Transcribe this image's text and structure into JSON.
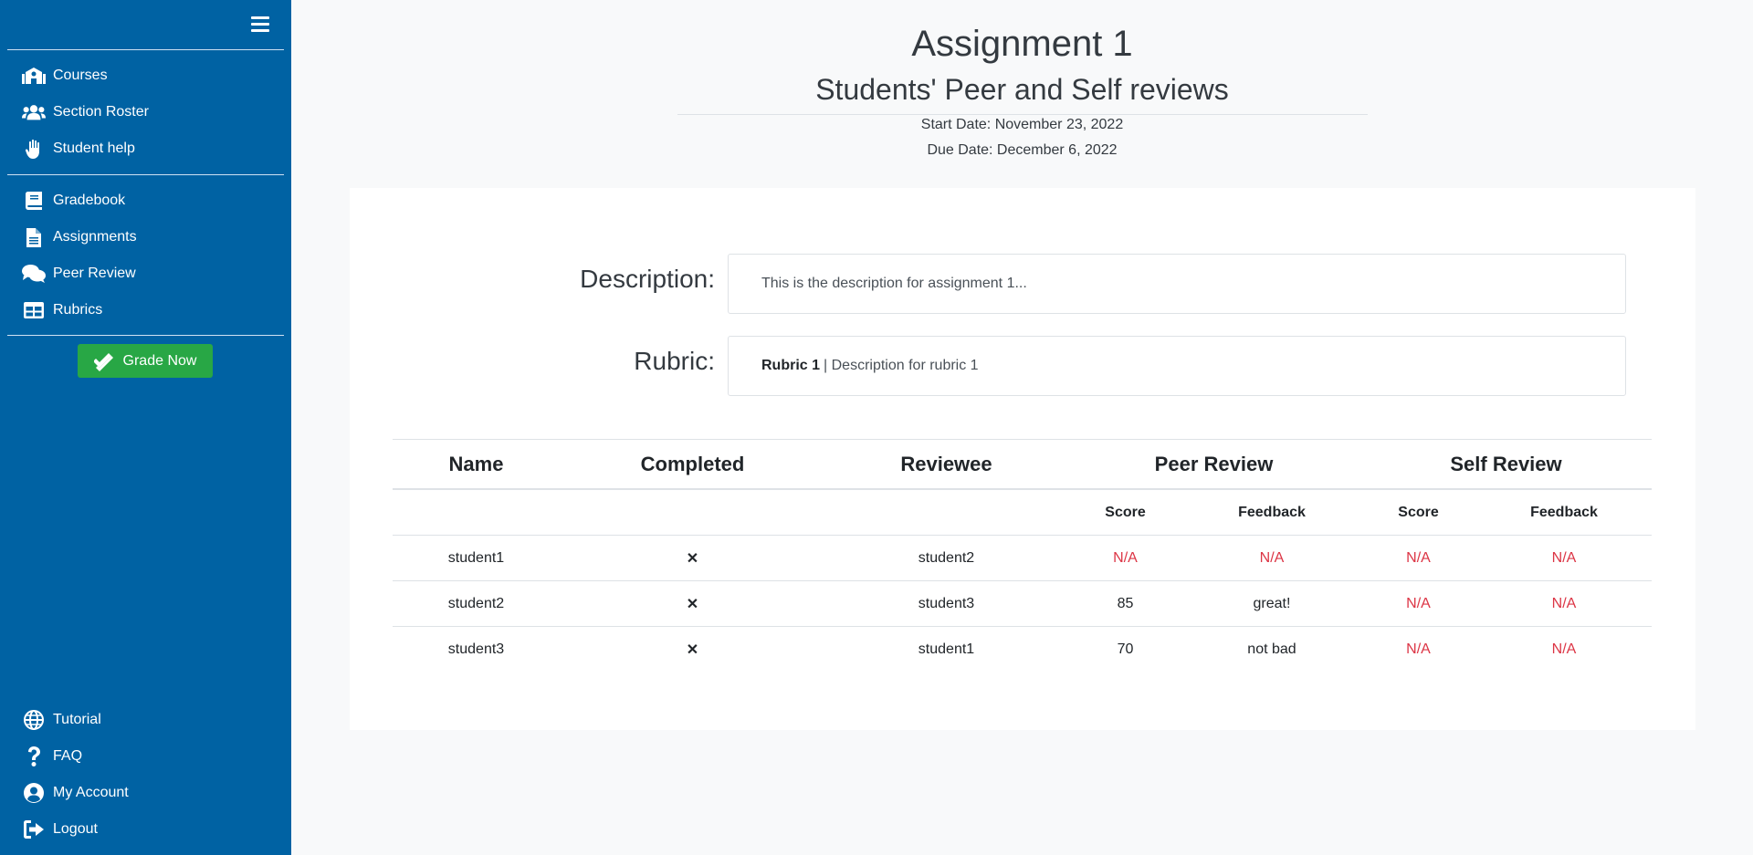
{
  "sidebar": {
    "menu_icon": "hamburger-icon",
    "top_items": [
      {
        "label": "Courses",
        "icon": "school-icon"
      },
      {
        "label": "Section Roster",
        "icon": "users-icon"
      },
      {
        "label": "Student help",
        "icon": "hand-icon"
      }
    ],
    "mid_items": [
      {
        "label": "Gradebook",
        "icon": "book-icon"
      },
      {
        "label": "Assignments",
        "icon": "file-icon"
      },
      {
        "label": "Peer Review",
        "icon": "comments-icon"
      },
      {
        "label": "Rubrics",
        "icon": "table-icon"
      }
    ],
    "grade_button": "Grade Now",
    "bottom_items": [
      {
        "label": "Tutorial",
        "icon": "globe-icon"
      },
      {
        "label": "FAQ",
        "icon": "question-icon"
      },
      {
        "label": "My Account",
        "icon": "user-circle-icon"
      },
      {
        "label": "Logout",
        "icon": "logout-icon"
      }
    ],
    "colors": {
      "background": "#0062a3",
      "grade_button": "#28a745"
    }
  },
  "header": {
    "title": "Assignment 1",
    "subtitle": "Students' Peer and Self reviews",
    "start_date": "Start Date: November 23, 2022",
    "due_date": "Due Date: December 6, 2022"
  },
  "details": {
    "description_label": "Description:",
    "description_text": "This is the description for assignment 1...",
    "rubric_label": "Rubric:",
    "rubric_name": "Rubric 1",
    "rubric_text": "| Description for rubric 1"
  },
  "table": {
    "headers": [
      "Name",
      "Completed",
      "Reviewee",
      "Peer Review",
      "Self Review"
    ],
    "subheaders": [
      "Score",
      "Feedback",
      "Score",
      "Feedback"
    ],
    "rows": [
      {
        "name": "student1",
        "completed": "✕",
        "reviewee": "student2",
        "peer_score": "N/A",
        "peer_feedback": "N/A",
        "self_score": "N/A",
        "self_feedback": "N/A"
      },
      {
        "name": "student2",
        "completed": "✕",
        "reviewee": "student3",
        "peer_score": "85",
        "peer_feedback": "great!",
        "self_score": "N/A",
        "self_feedback": "N/A"
      },
      {
        "name": "student3",
        "completed": "✕",
        "reviewee": "student1",
        "peer_score": "70",
        "peer_feedback": "not bad",
        "self_score": "N/A",
        "self_feedback": "N/A"
      }
    ],
    "colors": {
      "not_available": "#dc3545",
      "not_completed": "#dc3545"
    }
  }
}
